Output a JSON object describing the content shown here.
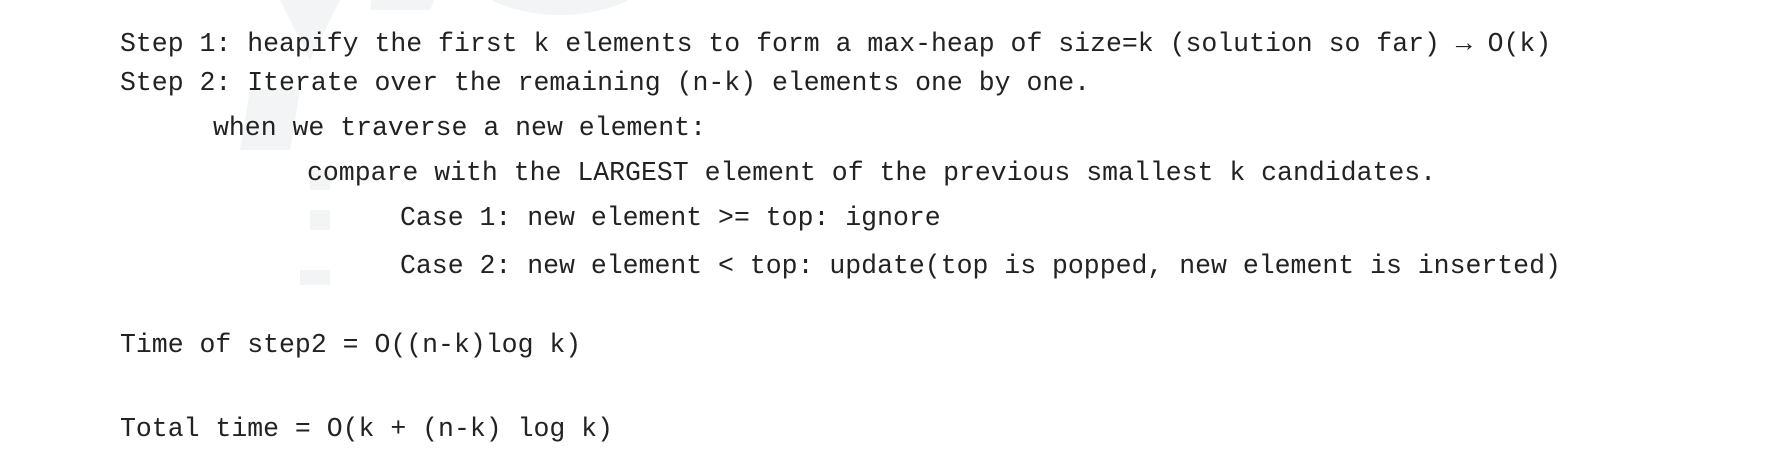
{
  "lines": {
    "step1": "Step 1: heapify the first k elements to form a max-heap of size=k (solution so far) → O(k)",
    "step2": "Step 2: Iterate over the remaining (n-k) elements one by one.",
    "traverse": "when we traverse a new element:",
    "compare": "compare with the LARGEST element of the previous smallest k candidates.",
    "case1": "Case 1: new element >= top: ignore",
    "case2": "Case 2: new element < top: update(top is popped, new element is inserted)",
    "time_step2": "Time of step2 = O((n-k)log k)",
    "total_time": "Total time = O(k + (n-k) log k)"
  }
}
